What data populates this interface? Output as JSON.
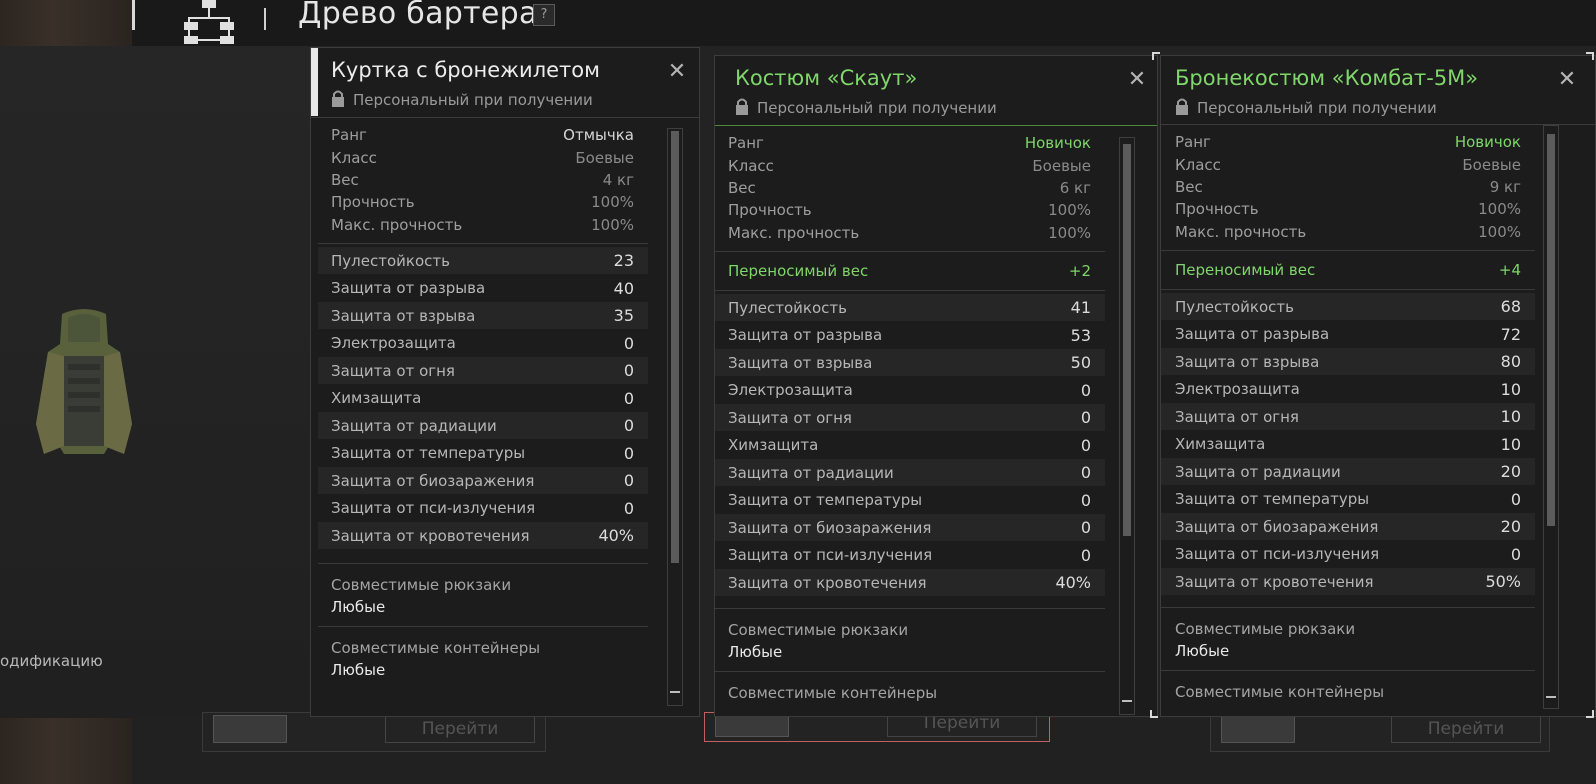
{
  "header": {
    "title": "Древо бартера",
    "help_label": "?"
  },
  "preview": {
    "mod_text": "одификацию"
  },
  "bottom": {
    "go_label": "Перейти"
  },
  "cards": [
    {
      "title": "Куртка с бронежилетом",
      "binding": "Персональный при получении",
      "info": [
        {
          "label": "Ранг",
          "value": "Отмычка"
        },
        {
          "label": "Класс",
          "value": "Боевые"
        },
        {
          "label": "Вес",
          "value": "4 кг"
        },
        {
          "label": "Прочность",
          "value": "100%"
        },
        {
          "label": "Макс. прочность",
          "value": "100%"
        }
      ],
      "stats": [
        {
          "label": "Пулестойкость",
          "value": "23"
        },
        {
          "label": "Защита от разрыва",
          "value": "40"
        },
        {
          "label": "Защита от взрыва",
          "value": "35"
        },
        {
          "label": "Электрозащита",
          "value": "0"
        },
        {
          "label": "Защита от огня",
          "value": "0"
        },
        {
          "label": "Химзащита",
          "value": "0"
        },
        {
          "label": "Защита от радиации",
          "value": "0"
        },
        {
          "label": "Защита от температуры",
          "value": "0"
        },
        {
          "label": "Защита от биозаражения",
          "value": "0"
        },
        {
          "label": "Защита от пси-излучения",
          "value": "0"
        },
        {
          "label": "Защита от кровотечения",
          "value": "40%"
        }
      ],
      "compat": [
        {
          "label": "Совместимые рюкзаки",
          "value": "Любые"
        },
        {
          "label": "Совместимые контейнеры",
          "value": "Любые"
        }
      ]
    },
    {
      "title": "Костюм «Скаут»",
      "binding": "Персональный при получении",
      "info": [
        {
          "label": "Ранг",
          "value": "Новичок"
        },
        {
          "label": "Класс",
          "value": "Боевые"
        },
        {
          "label": "Вес",
          "value": "6 кг"
        },
        {
          "label": "Прочность",
          "value": "100%"
        },
        {
          "label": "Макс. прочность",
          "value": "100%"
        }
      ],
      "bonus": {
        "label": "Переносимый вес",
        "value": "+2"
      },
      "stats": [
        {
          "label": "Пулестойкость",
          "value": "41"
        },
        {
          "label": "Защита от разрыва",
          "value": "53"
        },
        {
          "label": "Защита от взрыва",
          "value": "50"
        },
        {
          "label": "Электрозащита",
          "value": "0"
        },
        {
          "label": "Защита от огня",
          "value": "0"
        },
        {
          "label": "Химзащита",
          "value": "0"
        },
        {
          "label": "Защита от радиации",
          "value": "0"
        },
        {
          "label": "Защита от температуры",
          "value": "0"
        },
        {
          "label": "Защита от биозаражения",
          "value": "0"
        },
        {
          "label": "Защита от пси-излучения",
          "value": "0"
        },
        {
          "label": "Защита от кровотечения",
          "value": "40%"
        }
      ],
      "compat": [
        {
          "label": "Совместимые рюкзаки",
          "value": "Любые"
        },
        {
          "label": "Совместимые контейнеры",
          "value": ""
        }
      ]
    },
    {
      "title": "Бронекостюм «Комбат-5М»",
      "binding": "Персональный при получении",
      "info": [
        {
          "label": "Ранг",
          "value": "Новичок"
        },
        {
          "label": "Класс",
          "value": "Боевые"
        },
        {
          "label": "Вес",
          "value": "9 кг"
        },
        {
          "label": "Прочность",
          "value": "100%"
        },
        {
          "label": "Макс. прочность",
          "value": "100%"
        }
      ],
      "bonus": {
        "label": "Переносимый вес",
        "value": "+4"
      },
      "stats": [
        {
          "label": "Пулестойкость",
          "value": "68"
        },
        {
          "label": "Защита от разрыва",
          "value": "72"
        },
        {
          "label": "Защита от взрыва",
          "value": "80"
        },
        {
          "label": "Электрозащита",
          "value": "10"
        },
        {
          "label": "Защита от огня",
          "value": "10"
        },
        {
          "label": "Химзащита",
          "value": "10"
        },
        {
          "label": "Защита от радиации",
          "value": "20"
        },
        {
          "label": "Защита от температуры",
          "value": "0"
        },
        {
          "label": "Защита от биозаражения",
          "value": "20"
        },
        {
          "label": "Защита от пси-излучения",
          "value": "0"
        },
        {
          "label": "Защита от кровотечения",
          "value": "50%"
        }
      ],
      "compat": [
        {
          "label": "Совместимые рюкзаки",
          "value": "Любые"
        },
        {
          "label": "Совместимые контейнеры",
          "value": ""
        }
      ]
    }
  ],
  "colors": {
    "accent_green": "#7fd66a",
    "selected_border": "#c06060"
  },
  "icons": {
    "tree": "barter-tree-icon",
    "lock": "lock-icon",
    "close": "close-icon"
  }
}
